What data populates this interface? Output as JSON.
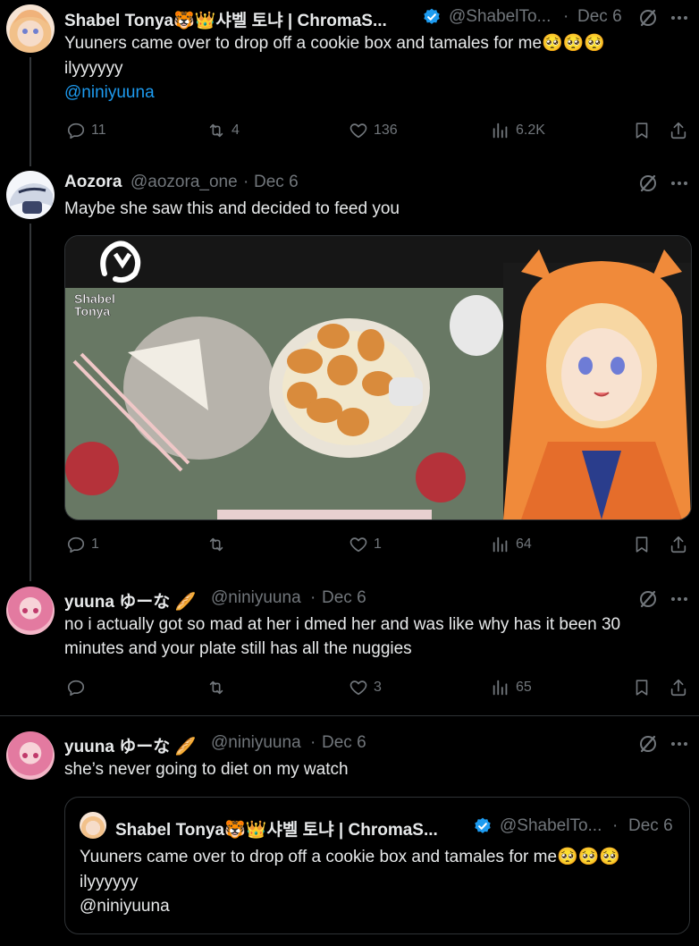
{
  "tweets": [
    {
      "name": "Shabel Tonya🐯👑샤벨 토냐 | ChromaS...",
      "handle": "@ShabelTo...",
      "dot": "·",
      "date": "Dec 6",
      "text_line1": "Yuuners came over to drop off a cookie box and tamales for me🥺🥺🥺",
      "text_line2": "ilyyyyyy",
      "mention": "@niniyuuna",
      "replies": "11",
      "retweets": "4",
      "likes": "136",
      "views": "6.2K"
    },
    {
      "name": "Aozora",
      "handle": "@aozora_one",
      "dot": "·",
      "date": "Dec 6",
      "text": "Maybe she saw this and decided to feed you",
      "media_logo": "Shabel Tonya",
      "replies": "1",
      "retweets": "",
      "likes": "1",
      "views": "64"
    },
    {
      "name": "yuuna ゆーな 🥖",
      "handle": "@niniyuuna",
      "dot": "·",
      "date": "Dec 6",
      "text_line1": "no i actually got so mad at her i dmed her and was like why has it been 30",
      "text_line2": "minutes and your plate still has all the nuggies",
      "replies": "",
      "retweets": "",
      "likes": "3",
      "views": "65"
    },
    {
      "name": "yuuna ゆーな 🥖",
      "handle": "@niniyuuna",
      "dot": "·",
      "date": "Dec 6",
      "text": "she’s never going to diet on my watch",
      "quote": {
        "name": "Shabel Tonya🐯👑샤벨 토냐 | ChromaS...",
        "handle": "@ShabelTo...",
        "dot": "·",
        "date": "Dec 6",
        "text_line1": "Yuuners came over to drop off a cookie box and tamales for me🥺🥺🥺",
        "text_line2": "ilyyyyyy",
        "text_line3": "@niniyuuna"
      }
    }
  ],
  "colors": {
    "background": "#000000",
    "text": "#e7e9ea",
    "muted": "#71767b",
    "link": "#1d9bf0",
    "verified": "#1d9bf0"
  },
  "icons": [
    "reply-icon",
    "retweet-icon",
    "like-icon",
    "views-icon",
    "bookmark-icon",
    "share-icon",
    "grok-icon",
    "more-icon",
    "verified-icon"
  ]
}
